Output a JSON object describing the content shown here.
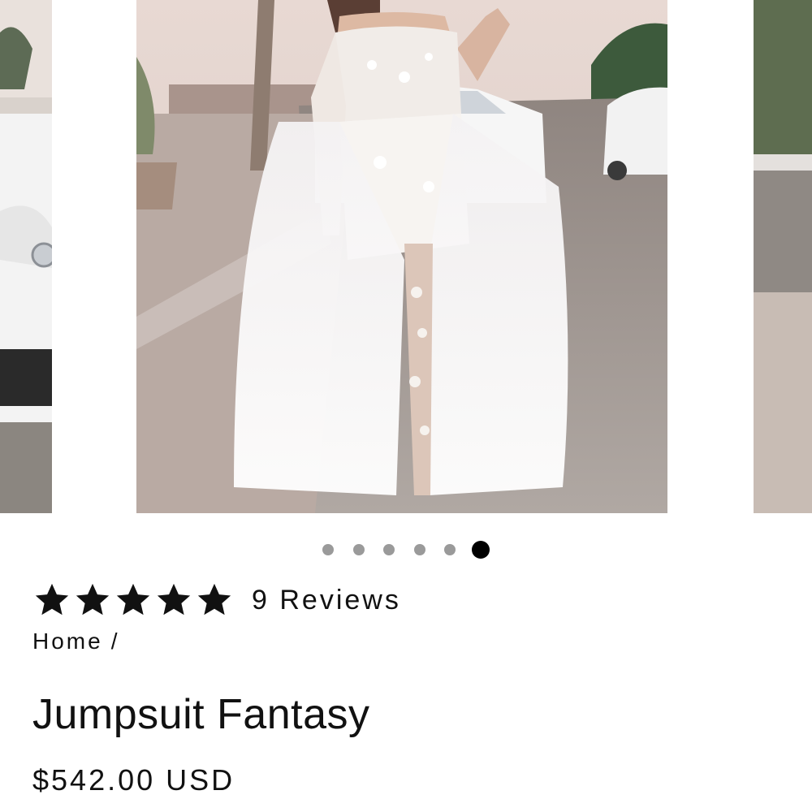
{
  "gallery": {
    "slide_count": 6,
    "active_index": 5
  },
  "rating": {
    "stars": 5,
    "reviews_label": "9 Reviews"
  },
  "breadcrumb": {
    "home": "Home",
    "separator": "/"
  },
  "product": {
    "title": "Jumpsuit Fantasy",
    "price": "$542.00 USD"
  },
  "colors": {
    "star": "#111111",
    "dot": "#9a9a9a",
    "dot_active": "#000000"
  },
  "icons": {
    "zoom": "magnifier-icon",
    "star": "star-icon"
  }
}
